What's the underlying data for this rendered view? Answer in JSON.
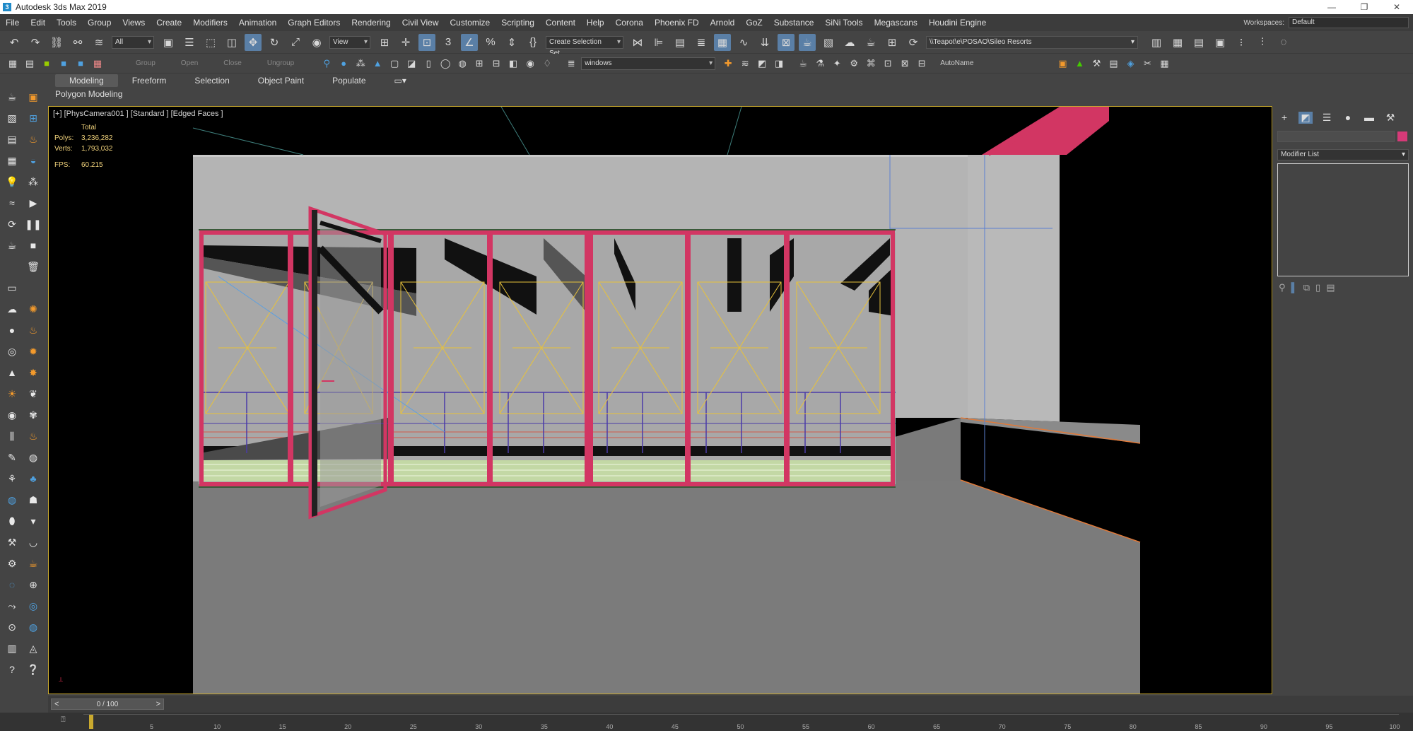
{
  "window": {
    "title": "Autodesk 3ds Max 2019",
    "app_icon": "3",
    "minimize": "—",
    "maximize": "❐",
    "close": "✕"
  },
  "menu": [
    "File",
    "Edit",
    "Tools",
    "Group",
    "Views",
    "Create",
    "Modifiers",
    "Animation",
    "Graph Editors",
    "Rendering",
    "Civil View",
    "Customize",
    "Scripting",
    "Content",
    "Help",
    "Corona",
    "Phoenix FD",
    "Arnold",
    "GoZ",
    "Substance",
    "SiNi Tools",
    "Megascans",
    "Houdini Engine"
  ],
  "workspace": {
    "label": "Workspaces:",
    "value": "Default"
  },
  "toolbar": {
    "selection_filter": "All",
    "reference_coord": "View",
    "named_selection": "Create Selection Set",
    "project_path": "\\\\Teapot\\e\\POSAO\\Sileo Resorts",
    "group_label": "Group",
    "open_label": "Open",
    "close_label": "Close",
    "ungroup_label": "Ungroup",
    "layer_value": "windows",
    "autoname_label": "AutoName"
  },
  "ribbon": {
    "tabs": [
      "Modeling",
      "Freeform",
      "Selection",
      "Object Paint",
      "Populate"
    ],
    "active_tab": "Modeling",
    "panel": "Polygon Modeling"
  },
  "viewport": {
    "label": "[+] [PhysCamera001 ] [Standard ] [Edged Faces ]",
    "stats": {
      "header": "Total",
      "polys_label": "Polys:",
      "polys": "3,236,282",
      "verts_label": "Verts:",
      "verts": "1,793,032",
      "fps_label": "FPS:",
      "fps": "60.215"
    }
  },
  "command_panel": {
    "modifier_list": "Modifier List",
    "selection_color": "#d63a78"
  },
  "time": {
    "slider_value": "0 / 100",
    "ticks": [
      "5",
      "10",
      "15",
      "20",
      "25",
      "30",
      "35",
      "40",
      "45",
      "50",
      "55",
      "60",
      "65",
      "70",
      "75",
      "80",
      "85",
      "90",
      "95",
      "100"
    ]
  },
  "colors": {
    "accent": "#5a7fa6",
    "viewport_border": "#c9a92e",
    "frame": "#d23663",
    "helper": "#e8c23a"
  }
}
